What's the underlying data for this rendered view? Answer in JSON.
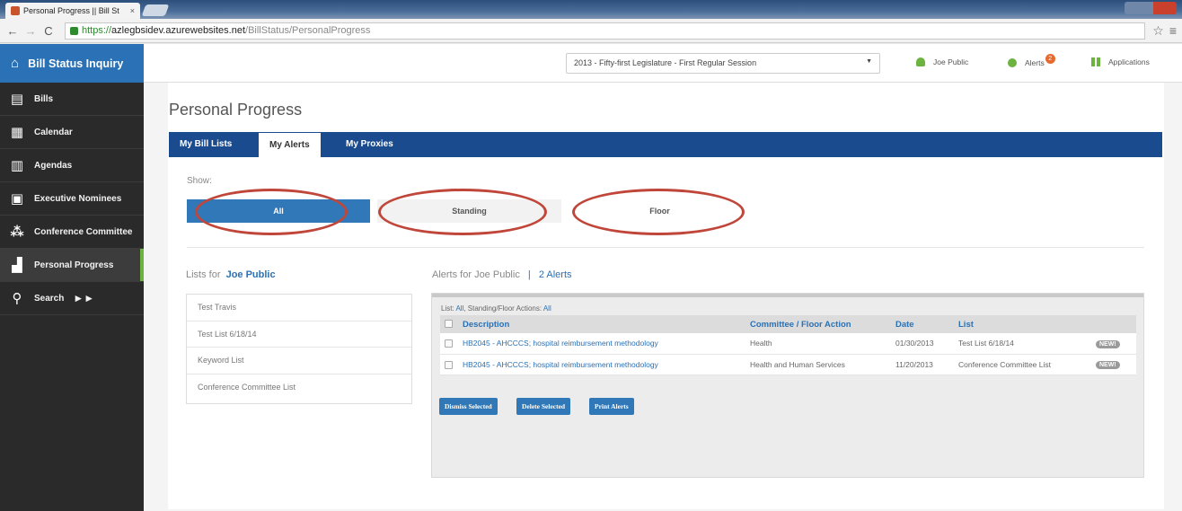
{
  "browser": {
    "tab_title": "Personal Progress || Bill St",
    "tab_close": "×",
    "url_scheme": "https://",
    "url_host": "azlegbsidev.azurewebsites.net",
    "url_path": "/BillStatus/PersonalProgress",
    "back": "←",
    "forward": "→",
    "reload": "C",
    "star": "☆",
    "menu": "≡"
  },
  "sidebar": {
    "brand": "Bill Status Inquiry",
    "items": [
      {
        "label": "Bills",
        "icon": "document-icon"
      },
      {
        "label": "Calendar",
        "icon": "calendar-icon"
      },
      {
        "label": "Agendas",
        "icon": "agenda-icon"
      },
      {
        "label": "Executive Nominees",
        "icon": "nominee-icon"
      },
      {
        "label": "Conference Committee",
        "icon": "people-icon"
      },
      {
        "label": "Personal Progress",
        "icon": "progress-icon"
      },
      {
        "label": "Search",
        "icon": "search-icon"
      }
    ]
  },
  "header": {
    "session": "2013 - Fifty-first Legislature - First Regular Session",
    "user": "Joe Public",
    "alerts_label": "Alerts",
    "alerts_count": "2",
    "applications": "Applications"
  },
  "page": {
    "title": "Personal Progress",
    "tabs": [
      "My Bill Lists",
      "My Alerts",
      "My Proxies"
    ],
    "show_label": "Show:",
    "filters": [
      "All",
      "Standing",
      "Floor"
    ]
  },
  "lists": {
    "label": "Lists for",
    "owner": "Joe Public",
    "items": [
      "Test Travis",
      "Test List 6/18/14",
      "Keyword List",
      "Conference Committee List"
    ]
  },
  "alerts": {
    "header": "Alerts for Joe Public",
    "separator": "|",
    "count": "2 Alerts",
    "filter_list_label": "List:",
    "filter_list_value": "All",
    "filter_action_label": ", Standing/Floor Actions:",
    "filter_action_value": "All",
    "columns": [
      "Description",
      "Committee / Floor Action",
      "Date",
      "List"
    ],
    "rows": [
      {
        "description": "HB2045 - AHCCCS; hospital reimbursement methodology",
        "committee": "Health",
        "date": "01/30/2013",
        "list": "Test List 6/18/14",
        "badge": "NEW!"
      },
      {
        "description": "HB2045 - AHCCCS; hospital reimbursement methodology",
        "committee": "Health and Human Services",
        "date": "11/20/2013",
        "list": "Conference Committee List",
        "badge": "NEW!"
      }
    ],
    "buttons": [
      "Dismiss Selected",
      "Delete Selected",
      "Print Alerts"
    ]
  },
  "colors": {
    "brand_blue": "#2a71b5",
    "tab_navy": "#1b4b8f",
    "active_green": "#6db33f",
    "annotation_red": "#c0463a"
  }
}
